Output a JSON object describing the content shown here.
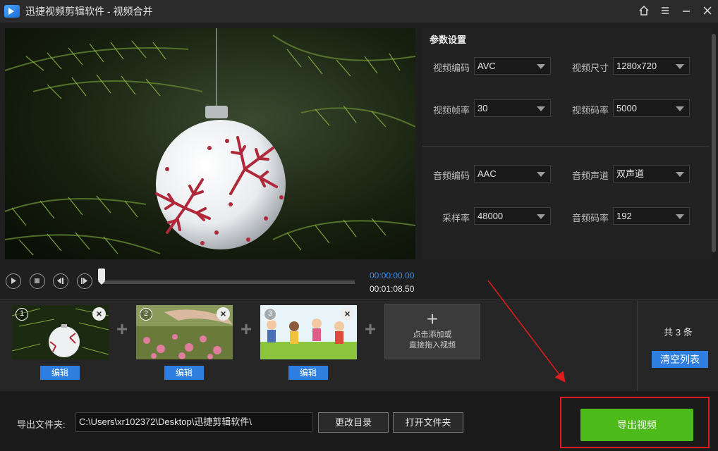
{
  "titlebar": {
    "title": "迅捷视频剪辑软件 - 视频合并",
    "icons": [
      "app-logo",
      "home-icon",
      "menu-icon",
      "minimize-icon",
      "close-icon"
    ]
  },
  "params": {
    "title": "参数设置",
    "video": {
      "codec_label": "视频编码",
      "codec": "AVC",
      "size_label": "视频尺寸",
      "size": "1280x720",
      "fps_label": "视频帧率",
      "fps": "30",
      "bitrate_label": "视频码率",
      "bitrate": "5000"
    },
    "audio": {
      "codec_label": "音频编码",
      "codec": "AAC",
      "channel_label": "音频声道",
      "channel": "双声道",
      "samplerate_label": "采样率",
      "samplerate": "48000",
      "bitrate_label": "音频码率",
      "bitrate": "192"
    }
  },
  "transport": {
    "current_time": "00:00:00.00",
    "total_time": "00:01:08.50",
    "progress": 0
  },
  "clips": [
    {
      "num": "1",
      "edit_label": "编辑"
    },
    {
      "num": "2",
      "edit_label": "编辑"
    },
    {
      "num": "3",
      "edit_label": "编辑"
    }
  ],
  "add_clip": {
    "line1": "点击添加或",
    "line2": "直接拖入视频"
  },
  "list": {
    "count_text": "共 3 条",
    "clear_label": "清空列表"
  },
  "output": {
    "folder_label": "导出文件夹:",
    "path": "C:\\Users\\xr102372\\Desktop\\迅捷剪辑软件\\",
    "change_dir_label": "更改目录",
    "open_folder_label": "打开文件夹",
    "export_label": "导出视频"
  },
  "colors": {
    "accent": "#2f7fe0",
    "export": "#4cba18",
    "highlight": "#e01b1b",
    "time": "#3b8fe8"
  }
}
